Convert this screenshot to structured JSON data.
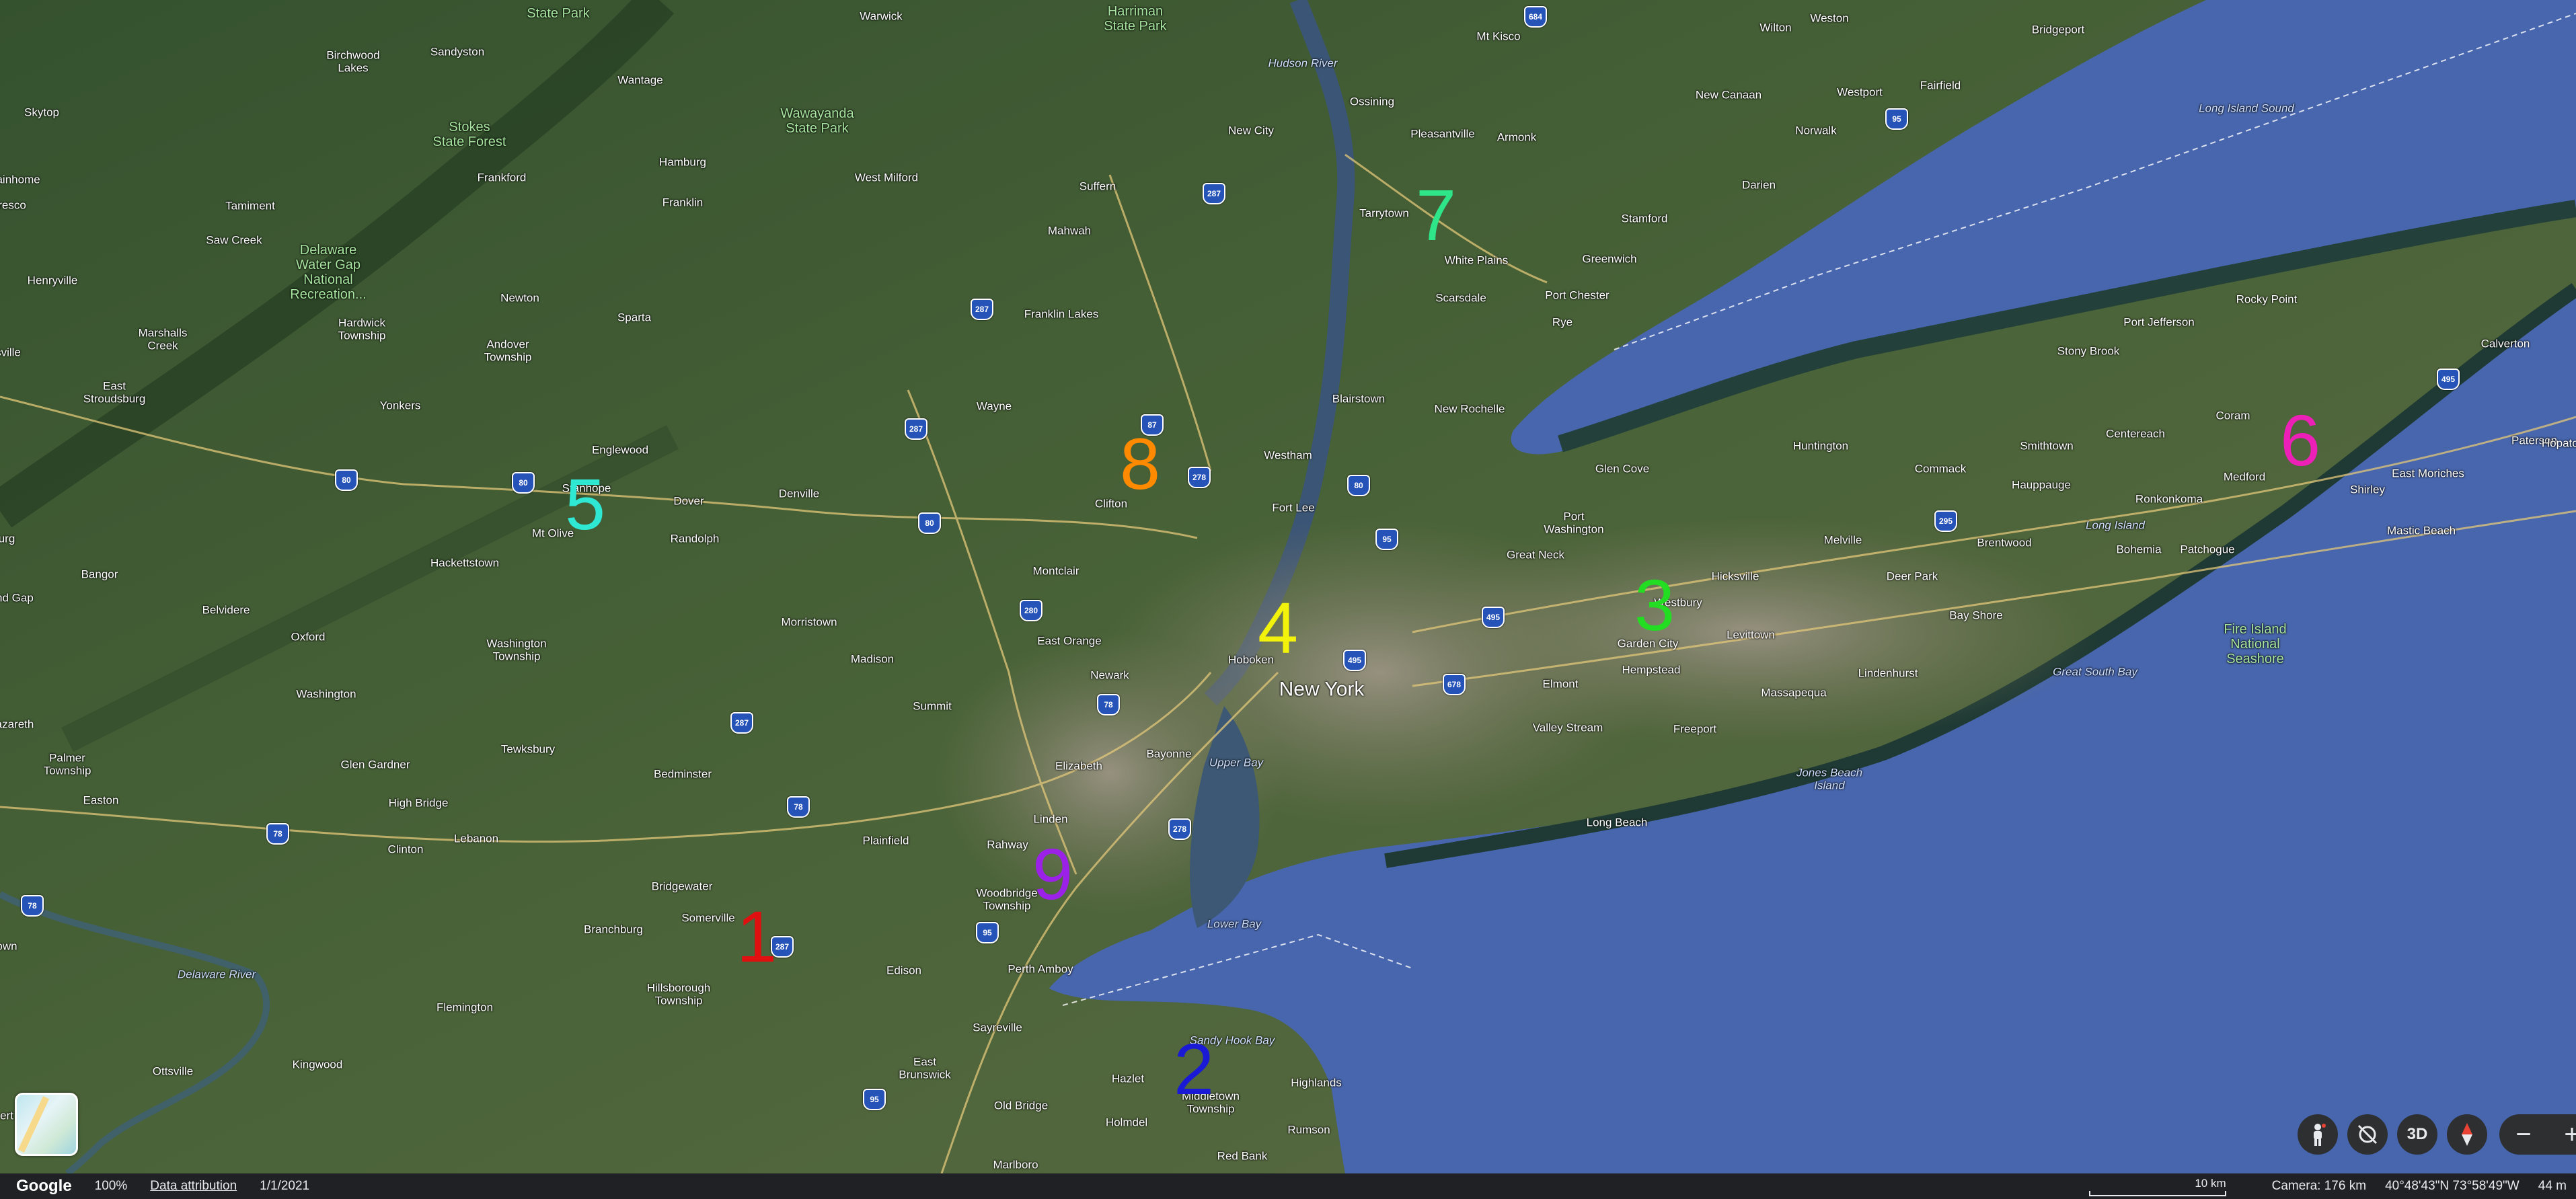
{
  "map": {
    "colors": {
      "water": "#4866ad",
      "land_dark": "#2f4d2c",
      "land_mid": "#47613a",
      "land_light": "#6d7a56",
      "urban": "#8b8677"
    },
    "places": [
      {
        "label": "State Park",
        "cls": "park"
      },
      {
        "label": "Warwick",
        "cls": ""
      },
      {
        "label": "Harriman\nState Park",
        "cls": "park"
      },
      {
        "label": "Mt Kisco",
        "cls": ""
      },
      {
        "label": "Wilton",
        "cls": ""
      },
      {
        "label": "Weston",
        "cls": ""
      },
      {
        "label": "Bridgeport",
        "cls": ""
      },
      {
        "label": "Birchwood\nLakes",
        "cls": ""
      },
      {
        "label": "Sandyston",
        "cls": ""
      },
      {
        "label": "Wantage",
        "cls": ""
      },
      {
        "label": "Skytop",
        "cls": ""
      },
      {
        "label": "Stokes\nState Forest",
        "cls": "park"
      },
      {
        "label": "Wawayanda\nState Park",
        "cls": "park"
      },
      {
        "label": "Hudson River",
        "cls": "water"
      },
      {
        "label": "Ossining",
        "cls": ""
      },
      {
        "label": "New City",
        "cls": ""
      },
      {
        "label": "New Canaan",
        "cls": ""
      },
      {
        "label": "Westport",
        "cls": ""
      },
      {
        "label": "Fairfield",
        "cls": ""
      },
      {
        "label": "Norwalk",
        "cls": ""
      },
      {
        "label": "Long Island Sound",
        "cls": "water"
      },
      {
        "label": "Pleasantville",
        "cls": ""
      },
      {
        "label": "Armonk",
        "cls": ""
      },
      {
        "label": "ntainhome",
        "cls": ""
      },
      {
        "label": "Hamburg",
        "cls": ""
      },
      {
        "label": "West Milford",
        "cls": ""
      },
      {
        "label": "Suffern",
        "cls": ""
      },
      {
        "label": "Frankford",
        "cls": ""
      },
      {
        "label": "Franklin",
        "cls": ""
      },
      {
        "label": "Darien",
        "cls": ""
      },
      {
        "label": "resco",
        "cls": ""
      },
      {
        "label": "Tamiment",
        "cls": ""
      },
      {
        "label": "Tarrytown",
        "cls": ""
      },
      {
        "label": "Stamford",
        "cls": ""
      },
      {
        "label": "Delaware\nWater Gap\nNational\nRecreation...",
        "cls": "park"
      },
      {
        "label": "Mahwah",
        "cls": ""
      },
      {
        "label": "Saw Creek",
        "cls": ""
      },
      {
        "label": "White Plains",
        "cls": ""
      },
      {
        "label": "Greenwich",
        "cls": ""
      },
      {
        "label": "Henryville",
        "cls": ""
      },
      {
        "label": "Newton",
        "cls": ""
      },
      {
        "label": "Scarsdale",
        "cls": ""
      },
      {
        "label": "Port Chester",
        "cls": ""
      },
      {
        "label": "Port Jefferson",
        "cls": ""
      },
      {
        "label": "Rocky Point",
        "cls": ""
      },
      {
        "label": "Marshalls\nCreek",
        "cls": ""
      },
      {
        "label": "Hardwick\nTownship",
        "cls": ""
      },
      {
        "label": "Sparta",
        "cls": ""
      },
      {
        "label": "Franklin Lakes",
        "cls": ""
      },
      {
        "label": "Rye",
        "cls": ""
      },
      {
        "label": "Calverton",
        "cls": ""
      },
      {
        "label": "Andover\nTownship",
        "cls": ""
      },
      {
        "label": "Stony Brook",
        "cls": ""
      },
      {
        "label": "sville",
        "cls": ""
      },
      {
        "label": "East\nStroudsburg",
        "cls": ""
      },
      {
        "label": "Yonkers",
        "cls": ""
      },
      {
        "label": "Blairstown",
        "cls": ""
      },
      {
        "label": "Wayne",
        "cls": ""
      },
      {
        "label": "New Rochelle",
        "cls": ""
      },
      {
        "label": "Huntington",
        "cls": ""
      },
      {
        "label": "Smithtown",
        "cls": ""
      },
      {
        "label": "Centereach",
        "cls": ""
      },
      {
        "label": "Coram",
        "cls": ""
      },
      {
        "label": "Paterson",
        "cls": ""
      },
      {
        "label": "Englewood",
        "cls": ""
      },
      {
        "label": "Westham",
        "cls": ""
      },
      {
        "label": "Hopatcong",
        "cls": ""
      },
      {
        "label": "Glen Cove",
        "cls": ""
      },
      {
        "label": "Commack",
        "cls": ""
      },
      {
        "label": "Hauppauge",
        "cls": ""
      },
      {
        "label": "Medford",
        "cls": ""
      },
      {
        "label": "East Moriches",
        "cls": ""
      },
      {
        "label": "Stanhope",
        "cls": ""
      },
      {
        "label": "Dover",
        "cls": ""
      },
      {
        "label": "Denville",
        "cls": ""
      },
      {
        "label": "Clifton",
        "cls": ""
      },
      {
        "label": "Fort Lee",
        "cls": ""
      },
      {
        "label": "Ronkonkoma",
        "cls": ""
      },
      {
        "label": "Shirley",
        "cls": ""
      },
      {
        "label": "Mt Olive",
        "cls": ""
      },
      {
        "label": "Randolph",
        "cls": ""
      },
      {
        "label": "Port\nWashington",
        "cls": ""
      },
      {
        "label": "Melville",
        "cls": ""
      },
      {
        "label": "Long Island",
        "cls": "water"
      },
      {
        "label": "Mastic Beach",
        "cls": ""
      },
      {
        "label": "urg",
        "cls": ""
      },
      {
        "label": "Hackettstown",
        "cls": ""
      },
      {
        "label": "Brentwood",
        "cls": ""
      },
      {
        "label": "Bohemia",
        "cls": ""
      },
      {
        "label": "Patchogue",
        "cls": ""
      },
      {
        "label": "Bangor",
        "cls": ""
      },
      {
        "label": "Great Neck",
        "cls": ""
      },
      {
        "label": "Montclair",
        "cls": ""
      },
      {
        "label": "Hicksville",
        "cls": ""
      },
      {
        "label": "Deer Park",
        "cls": ""
      },
      {
        "label": "ind Gap",
        "cls": ""
      },
      {
        "label": "Belvidere",
        "cls": ""
      },
      {
        "label": "Westbury",
        "cls": ""
      },
      {
        "label": "Morristown",
        "cls": ""
      },
      {
        "label": "Levittown",
        "cls": ""
      },
      {
        "label": "Bay Shore",
        "cls": ""
      },
      {
        "label": "Fire Island\nNational\nSeashore",
        "cls": "park"
      },
      {
        "label": "Oxford",
        "cls": ""
      },
      {
        "label": "East Orange",
        "cls": ""
      },
      {
        "label": "Washington\nTownship",
        "cls": ""
      },
      {
        "label": "Hoboken",
        "cls": ""
      },
      {
        "label": "Garden City",
        "cls": ""
      },
      {
        "label": "Madison",
        "cls": ""
      },
      {
        "label": "Newark",
        "cls": ""
      },
      {
        "label": "Hempstead",
        "cls": ""
      },
      {
        "label": "Lindenhurst",
        "cls": ""
      },
      {
        "label": "Great South Bay",
        "cls": "water"
      },
      {
        "label": "New York",
        "cls": "big"
      },
      {
        "label": "Elmont",
        "cls": ""
      },
      {
        "label": "Massapequa",
        "cls": ""
      },
      {
        "label": "Washington",
        "cls": ""
      },
      {
        "label": "Summit",
        "cls": ""
      },
      {
        "label": "Valley Stream",
        "cls": ""
      },
      {
        "label": "Freeport",
        "cls": ""
      },
      {
        "label": "azareth",
        "cls": ""
      },
      {
        "label": "Tewksbury",
        "cls": ""
      },
      {
        "label": "Bayonne",
        "cls": ""
      },
      {
        "label": "Upper Bay",
        "cls": "water"
      },
      {
        "label": "Palmer\nTownship",
        "cls": ""
      },
      {
        "label": "Glen Gardner",
        "cls": ""
      },
      {
        "label": "Elizabeth",
        "cls": ""
      },
      {
        "label": "Jones Beach\nIsland",
        "cls": "water"
      },
      {
        "label": "Bedminster",
        "cls": ""
      },
      {
        "label": "Easton",
        "cls": ""
      },
      {
        "label": "High Bridge",
        "cls": ""
      },
      {
        "label": "Linden",
        "cls": ""
      },
      {
        "label": "Long Beach",
        "cls": ""
      },
      {
        "label": "Lebanon",
        "cls": ""
      },
      {
        "label": "Plainfield",
        "cls": ""
      },
      {
        "label": "Clinton",
        "cls": ""
      },
      {
        "label": "Rahway",
        "cls": ""
      },
      {
        "label": "Bridgewater",
        "cls": ""
      },
      {
        "label": "Woodbridge\nTownship",
        "cls": ""
      },
      {
        "label": "Somerville",
        "cls": ""
      },
      {
        "label": "Lower Bay",
        "cls": "water"
      },
      {
        "label": "Branchburg",
        "cls": ""
      },
      {
        "label": "Delaware River",
        "cls": "water"
      },
      {
        "label": "own",
        "cls": ""
      },
      {
        "label": "Edison",
        "cls": ""
      },
      {
        "label": "Perth Amboy",
        "cls": ""
      },
      {
        "label": "Hillsborough\nTownship",
        "cls": ""
      },
      {
        "label": "Flemington",
        "cls": ""
      },
      {
        "label": "Sayreville",
        "cls": ""
      },
      {
        "label": "Sandy Hook Bay",
        "cls": "water"
      },
      {
        "label": "East\nBrunswick",
        "cls": ""
      },
      {
        "label": "Kingwood",
        "cls": ""
      },
      {
        "label": "Ottsville",
        "cls": ""
      },
      {
        "label": "Hazlet",
        "cls": ""
      },
      {
        "label": "Highlands",
        "cls": ""
      },
      {
        "label": "Middletown\nTownship",
        "cls": ""
      },
      {
        "label": "Old Bridge",
        "cls": ""
      },
      {
        "label": "Holmdel",
        "cls": ""
      },
      {
        "label": "Rumson",
        "cls": ""
      },
      {
        "label": "Red Bank",
        "cls": ""
      },
      {
        "label": "Marlboro",
        "cls": ""
      },
      {
        "label": "ert",
        "cls": ""
      }
    ],
    "highway_shields": [
      "684",
      "95",
      "287",
      "287",
      "287",
      "87",
      "80",
      "80",
      "80",
      "80",
      "278",
      "95",
      "495",
      "295",
      "495",
      "495",
      "678",
      "280",
      "78",
      "287",
      "78",
      "278",
      "78",
      "287",
      "95",
      "95",
      "78"
    ],
    "markers": [
      {
        "label": "1",
        "color": "#e01010"
      },
      {
        "label": "2",
        "color": "#1a1ad6"
      },
      {
        "label": "3",
        "color": "#22dd22"
      },
      {
        "label": "4",
        "color": "#f2f20a"
      },
      {
        "label": "5",
        "color": "#2fe8d4"
      },
      {
        "label": "6",
        "color": "#ec1fb6"
      },
      {
        "label": "7",
        "color": "#2ee58a"
      },
      {
        "label": "8",
        "color": "#ff8a00"
      },
      {
        "label": "9",
        "color": "#9b20e8"
      }
    ]
  },
  "controls": {
    "pegman_icon": "person-icon",
    "tilt_icon": "tilt-off-icon",
    "three_d_label": "3D",
    "compass_icon": "compass-icon",
    "zoom_out_label": "−",
    "zoom_in_label": "+"
  },
  "status": {
    "logo": "Google",
    "zoom": "100%",
    "attribution": "Data attribution",
    "date": "1/1/2021",
    "scale_label": "10 km",
    "camera": "Camera: 176 km",
    "coords": "40°48'43\"N 73°58'49\"W",
    "elevation": "44 m"
  }
}
